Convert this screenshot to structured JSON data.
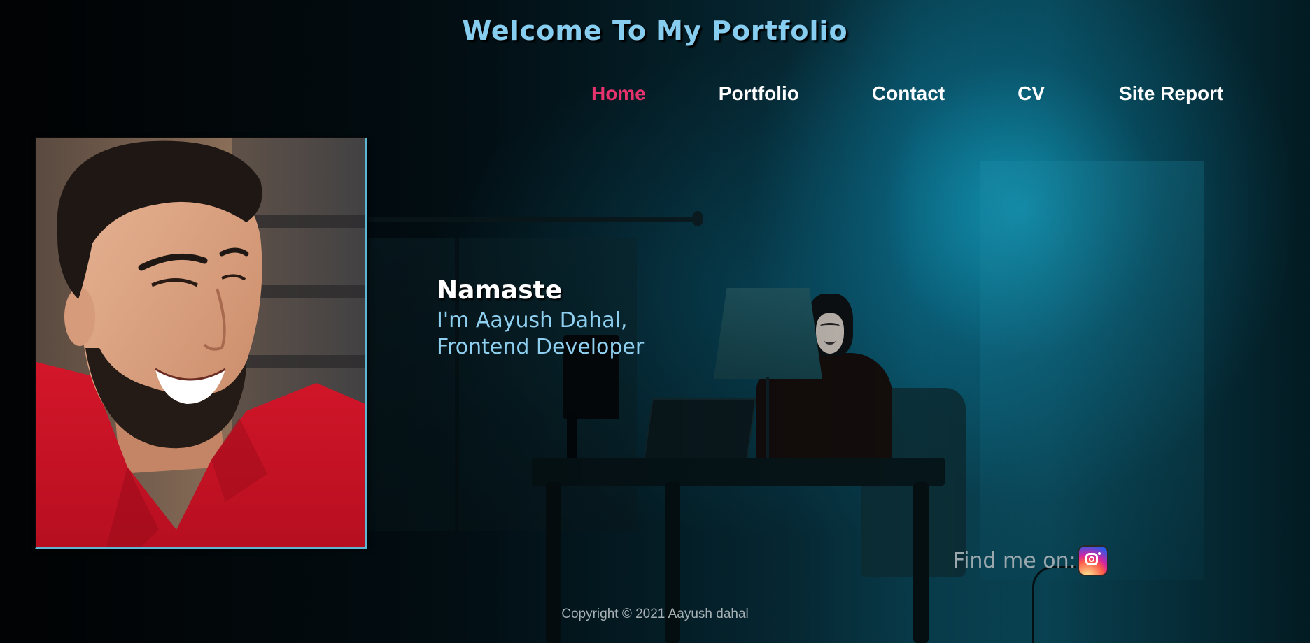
{
  "header": {
    "title": "Welcome To My Portfolio"
  },
  "nav": {
    "items": [
      {
        "label": "Home",
        "active": true
      },
      {
        "label": "Portfolio",
        "active": false
      },
      {
        "label": "Contact",
        "active": false
      },
      {
        "label": "CV",
        "active": false
      },
      {
        "label": "Site Report",
        "active": false
      }
    ]
  },
  "intro": {
    "greeting": "Namaste",
    "line1": "I'm Aayush Dahal,",
    "line2": "Frontend Developer"
  },
  "social": {
    "label": "Find me on:",
    "icon": "instagram-icon"
  },
  "footer": {
    "copyright": "Copyright © 2021 Aayush dahal"
  },
  "colors": {
    "title": "#87cdf0",
    "nav_active": "#e6336e",
    "accent_border": "#5fb6d3",
    "intro_text": "#8fd0f0"
  }
}
